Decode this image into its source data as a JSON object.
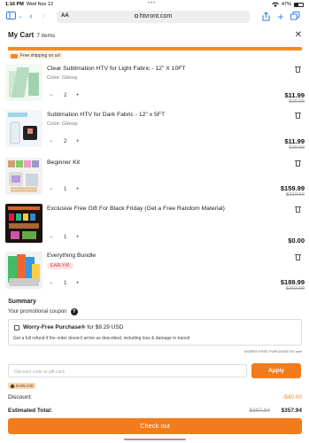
{
  "status_bar": {
    "time": "1:16 PM",
    "date": "Wed Nov 12",
    "battery": "47%"
  },
  "browser": {
    "url": "htvront.com",
    "text_size": "AA"
  },
  "cart": {
    "title": "My Cart",
    "count": "7 items",
    "shipping_note": "Free shipping on us!"
  },
  "items": [
    {
      "title": "Clear Sublimation HTV for Light Fabric - 12\" X 10FT",
      "variant": "Color: Glossy",
      "qty": "2",
      "price": "$11.99",
      "old_price": "$16.99"
    },
    {
      "title": "Sublimation HTV for Dark Fabric - 12\" x 5FT",
      "variant": "Color: Glossy",
      "qty": "2",
      "price": "$11.99",
      "old_price": "$19.99"
    },
    {
      "title": "Beginner Kit",
      "variant": "",
      "qty": "1",
      "price": "$159.99",
      "old_price": "$210.56"
    },
    {
      "title": "Exclusive Free Gift For Black Friday (Get a Free Random Material)",
      "variant": "",
      "qty": "1",
      "price": "$0.00",
      "old_price": ""
    },
    {
      "title": "Everything Bundle",
      "coupon": "EARLY40",
      "qty": "1",
      "price": "$189.99",
      "old_price": "$362.99"
    }
  ],
  "summary": {
    "title": "Summary",
    "promo_label": "Your promotional coupon",
    "worry_title_bold": "Worry-Free Purchase®",
    "worry_title_rest": " for $9.29 USD",
    "worry_desc": "Get a full refund if the order doesn't arrive as described, including loss & damage in transit",
    "worry_by": "WORRY-FREE PURCHASE BY seel",
    "discount_placeholder": "Discount code or gift card",
    "apply_label": "Apply",
    "applied_code": "EARLY40",
    "discount_label": "Discount:",
    "discount_value": "-$40.00",
    "total_label": "Estimated Total:",
    "total_old": "$397.94",
    "total_value": "$357.94",
    "checkout_label": "Check out"
  },
  "colors": {
    "accent": "#f27c1c",
    "link": "#2a7cf0"
  }
}
